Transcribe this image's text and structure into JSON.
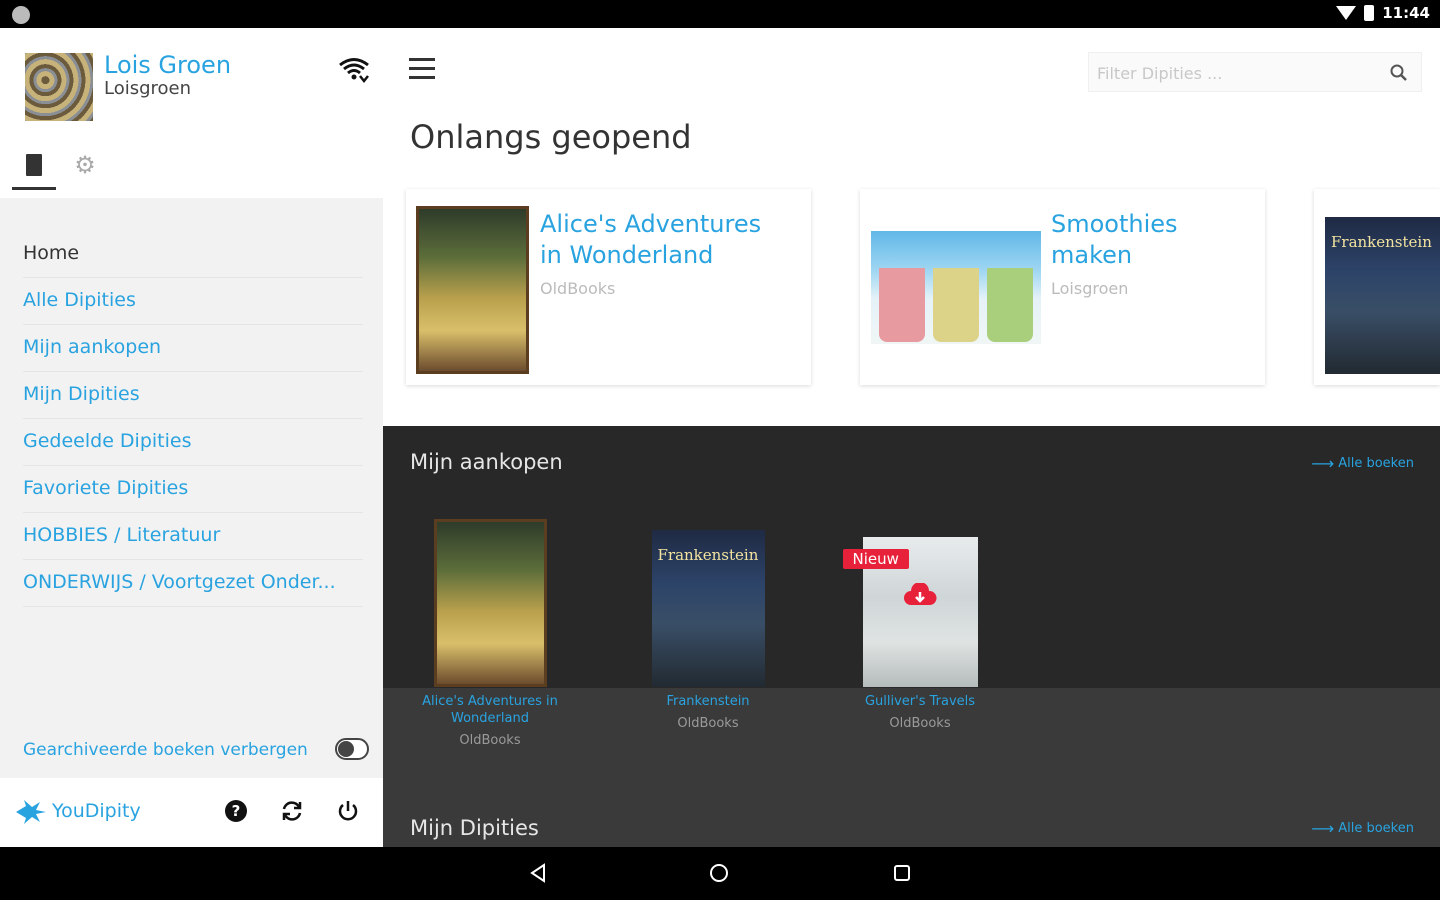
{
  "status": {
    "time": "11:44"
  },
  "profile": {
    "name": "Lois Groen",
    "username": "Loisgroen"
  },
  "nav": [
    {
      "label": "Home"
    },
    {
      "label": "Alle Dipities"
    },
    {
      "label": "Mijn aankopen"
    },
    {
      "label": "Mijn Dipities"
    },
    {
      "label": "Gedeelde Dipities"
    },
    {
      "label": "Favoriete Dipities"
    },
    {
      "label": "HOBBIES / Literatuur"
    },
    {
      "label": "ONDERWIJS / Voortgezet Onder..."
    }
  ],
  "archive_toggle": {
    "label": "Gearchiveerde boeken verbergen",
    "on": false
  },
  "footer": {
    "brand": "YouDipity"
  },
  "search": {
    "placeholder": "Filter Dipities ..."
  },
  "recent": {
    "title": "Onlangs geopend",
    "cards": [
      {
        "title": "Alice's Adventures in Wonderland",
        "publisher": "OldBooks"
      },
      {
        "title": "Smoothies maken",
        "publisher": "Loisgroen"
      },
      {
        "cover_title": "Frankenstein"
      }
    ]
  },
  "purchases": {
    "title": "Mijn aankopen",
    "all_link": "Alle boeken",
    "books": [
      {
        "title": "Alice's Adventures in Wonderland",
        "publisher": "OldBooks"
      },
      {
        "title": "Frankenstein",
        "publisher": "OldBooks",
        "cover_title": "Frankenstein"
      },
      {
        "title": "Gulliver's Travels",
        "publisher": "OldBooks",
        "badge": "Nieuw"
      }
    ]
  },
  "mydipities": {
    "title": "Mijn Dipities",
    "all_link": "Alle boeken"
  },
  "colors": {
    "accent": "#29a3e0",
    "dark": "#282828",
    "badge": "#e8213a"
  }
}
